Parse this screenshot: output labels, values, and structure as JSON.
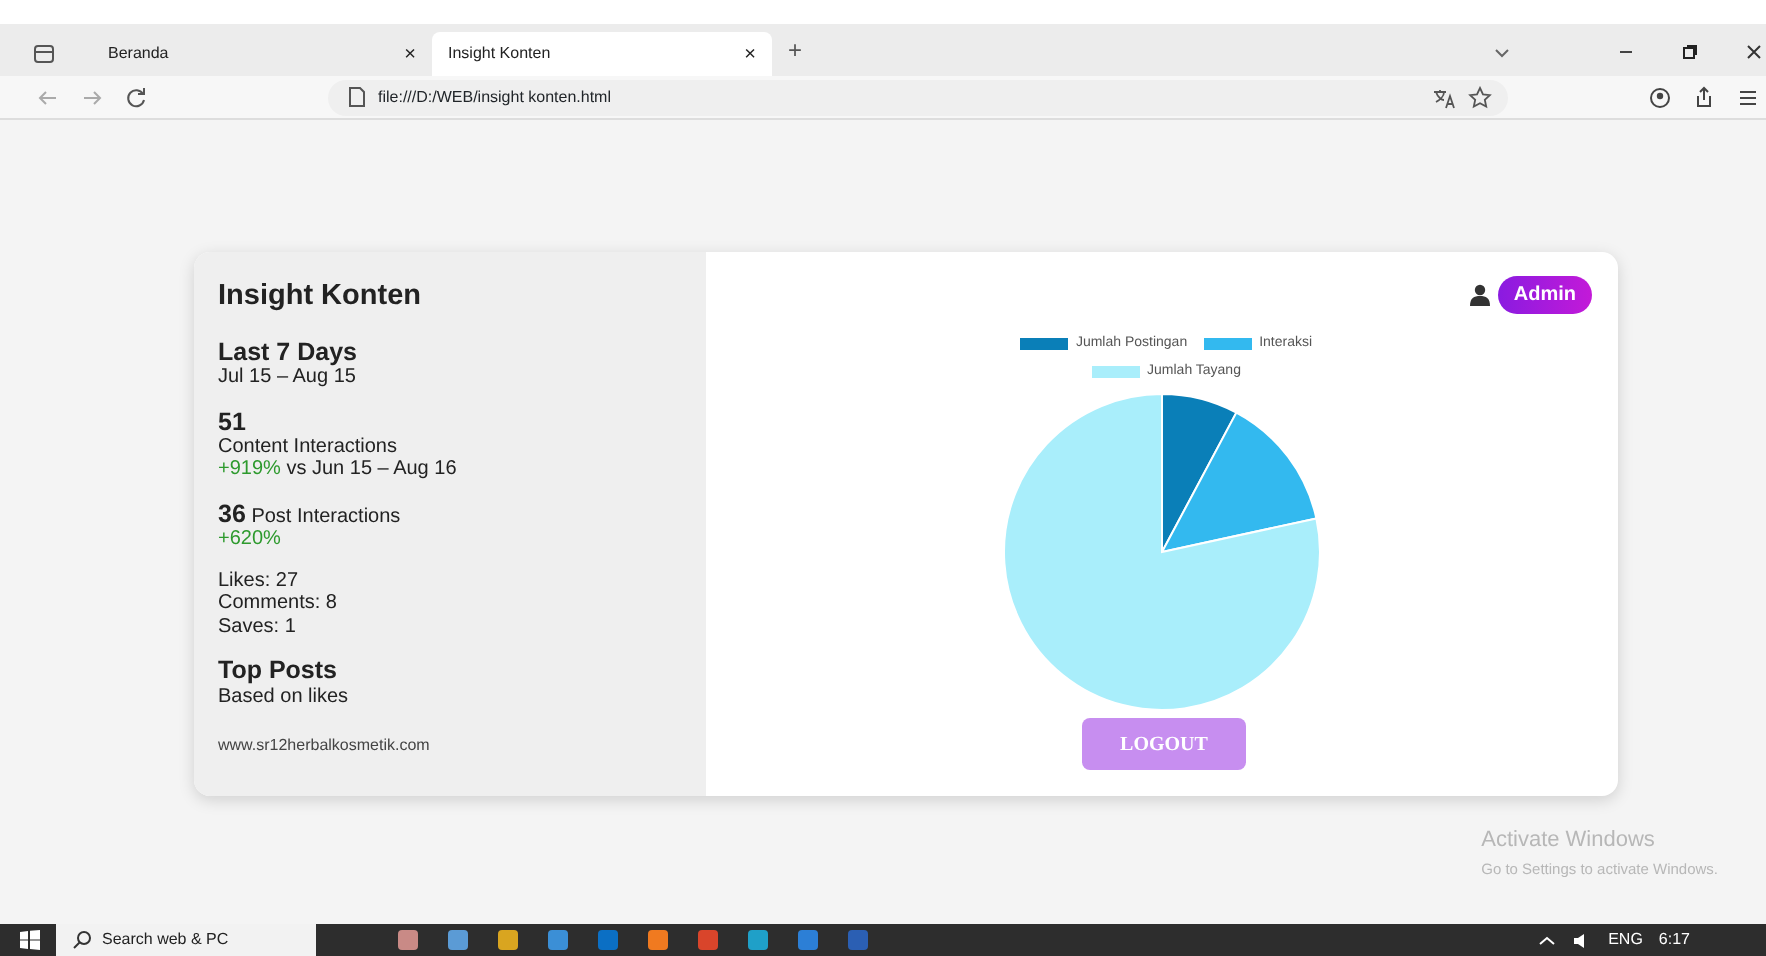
{
  "browser": {
    "tabs": [
      {
        "label": "Beranda",
        "close": "×",
        "selected": false
      },
      {
        "label": "Insight Konten",
        "close": "×",
        "selected": true
      }
    ],
    "new_tab": "+",
    "address": "file:///D:/WEB/insight konten.html"
  },
  "insight": {
    "title": "Insight Konten",
    "period": {
      "title": "Last 7 Days",
      "range": "Jul 15 – Aug 15"
    },
    "content": {
      "value": "51",
      "label": "Content Interactions",
      "change": "+919%",
      "comparison": "vs Jun 15 – Aug 16"
    },
    "post": {
      "value": "36",
      "label": "Post Interactions",
      "change": "+620%"
    },
    "stats": [
      "Likes: 27",
      "Comments: 8",
      "Saves: 1"
    ],
    "top_posts": {
      "title": "Top Posts",
      "subtitle": "Based on likes"
    },
    "website": "www.sr12herbalkosmetik.com"
  },
  "panel": {
    "user_badge": "Admin",
    "legend": [
      {
        "name": "Jumlah Postingan",
        "color": "#0a7fb8"
      },
      {
        "name": "Interaksi",
        "color": "#33b9ef"
      },
      {
        "name": "Jumlah Tayang",
        "color": "#a9eefb"
      }
    ],
    "logout": "LOGOUT"
  },
  "os_notice": {
    "title": "Activate Windows",
    "subtitle": "Go to Settings to activate Windows."
  },
  "taskbar": {
    "search": "Search web & PC",
    "language": "ENG",
    "time": "6:17"
  }
}
